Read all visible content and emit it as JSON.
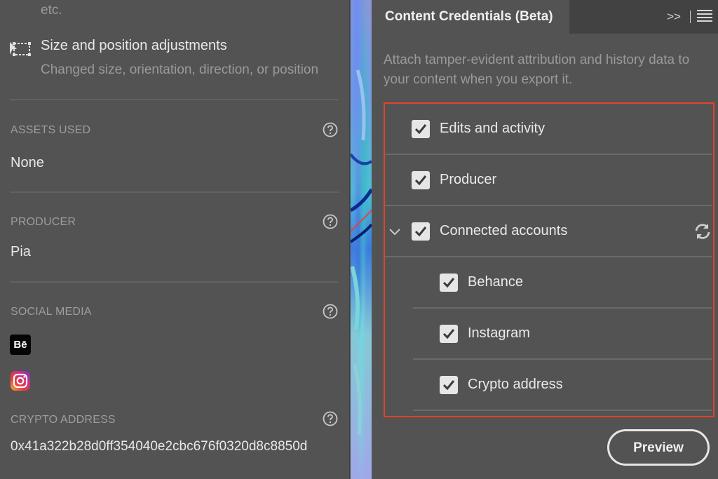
{
  "left": {
    "etc_text": "etc.",
    "adjustments": {
      "icon": "size-position-icon",
      "title": "Size and position adjustments",
      "description": "Changed size, orientation, direction, or position"
    },
    "assets_used": {
      "label": "ASSETS USED",
      "value": "None"
    },
    "producer": {
      "label": "PRODUCER",
      "value": "Pia"
    },
    "social_media": {
      "label": "SOCIAL MEDIA",
      "behance_glyph": "Bē",
      "accounts": [
        "behance-icon",
        "instagram-icon"
      ]
    },
    "crypto_address": {
      "label": "CRYPTO ADDRESS",
      "value": "0x41a322b28d0ff354040e2cbc676f0320d8c8850d"
    },
    "help_icon": "help-circle-icon"
  },
  "right": {
    "tab_title": "Content Credentials (Beta)",
    "collapse_glyph": ">>",
    "description": "Attach tamper-evident attribution and history data to your content when you export it.",
    "options": [
      {
        "label": "Edits and activity",
        "checked": true
      },
      {
        "label": "Producer",
        "checked": true
      },
      {
        "label": "Connected accounts",
        "checked": true,
        "expanded": true
      },
      {
        "label": "Behance",
        "checked": true
      },
      {
        "label": "Instagram",
        "checked": true
      },
      {
        "label": "Crypto address",
        "checked": true
      }
    ],
    "preview_label": "Preview"
  },
  "colors": {
    "panel_bg": "#535353",
    "tabbar_bg": "#424242",
    "highlight_border": "#e0442a",
    "text_primary": "#e8e8e8",
    "text_secondary": "#9a9a9a"
  }
}
